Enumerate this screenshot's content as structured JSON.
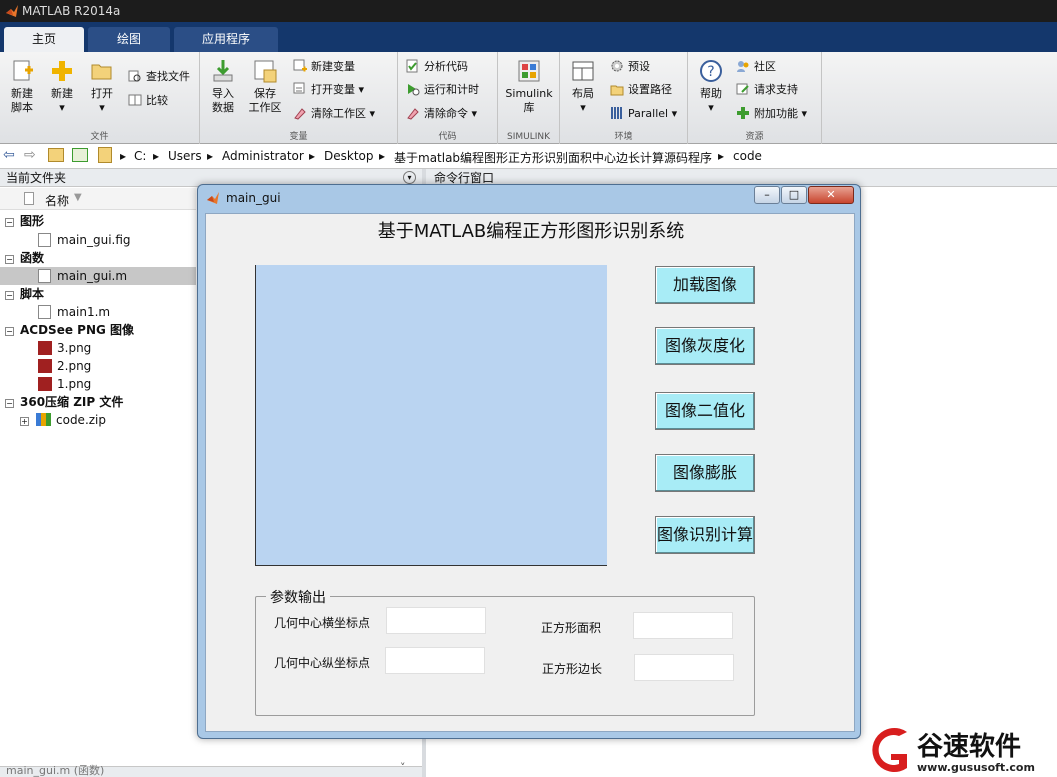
{
  "app": {
    "title": "MATLAB R2014a"
  },
  "tabs": [
    "主页",
    "绘图",
    "应用程序"
  ],
  "ribbon": {
    "file": {
      "new_script": "新建\n脚本",
      "new": "新建",
      "open": "打开",
      "find_files": "查找文件",
      "compare": "比较",
      "caption": "文件"
    },
    "variable": {
      "import": "导入\n数据",
      "save": "保存\n工作区",
      "new_var": "新建变量",
      "open_var": "打开变量",
      "clear_ws": "清除工作区",
      "caption": "变量"
    },
    "code": {
      "analyze": "分析代码",
      "run_time": "运行和计时",
      "clear_cmd": "清除命令",
      "caption": "代码"
    },
    "simulink": {
      "lib": "Simulink\n库",
      "caption": "SIMULINK"
    },
    "env": {
      "layout": "布局",
      "prefs": "预设",
      "set_path": "设置路径",
      "parallel": "Parallel",
      "caption": "环境"
    },
    "res": {
      "help": "帮助",
      "community": "社区",
      "support": "请求支持",
      "addons": "附加功能",
      "caption": "资源"
    }
  },
  "address": {
    "parts": [
      "C:",
      "Users",
      "Administrator",
      "Desktop",
      "基于matlab编程图形正方形识别面积中心边长计算源码程序",
      "code"
    ]
  },
  "current_folder": {
    "title": "当前文件夹",
    "column": "名称",
    "groups": [
      {
        "label": "图形",
        "items": [
          "main_gui.fig"
        ]
      },
      {
        "label": "函数",
        "items": [
          "main_gui.m"
        ]
      },
      {
        "label": "脚本",
        "items": [
          "main1.m"
        ]
      },
      {
        "label": "ACDSee PNG 图像",
        "items": [
          "3.png",
          "2.png",
          "1.png"
        ]
      },
      {
        "label": "360压缩 ZIP 文件",
        "items": [
          "code.zip"
        ]
      }
    ],
    "status": "main_gui.m (函数)"
  },
  "command_window": {
    "title": "命令行窗口"
  },
  "gui": {
    "window_title": "main_gui",
    "heading": "基于MATLAB编程正方形图形识别系统",
    "buttons": [
      "加载图像",
      "图像灰度化",
      "图像二值化",
      "图像膨胀",
      "图像识别计算"
    ],
    "panel": {
      "title": "参数输出",
      "cx_label": "几何中心横坐标点",
      "cy_label": "几何中心纵坐标点",
      "area_label": "正方形面积",
      "side_label": "正方形边长"
    }
  },
  "watermark": {
    "text": "谷速软件",
    "url": "www.gususoft.com"
  },
  "colors": {
    "tab_bar": "#14376c",
    "button": "#a8ecf6",
    "axes": "#bad4f1",
    "selected": "#c7c7c7"
  }
}
